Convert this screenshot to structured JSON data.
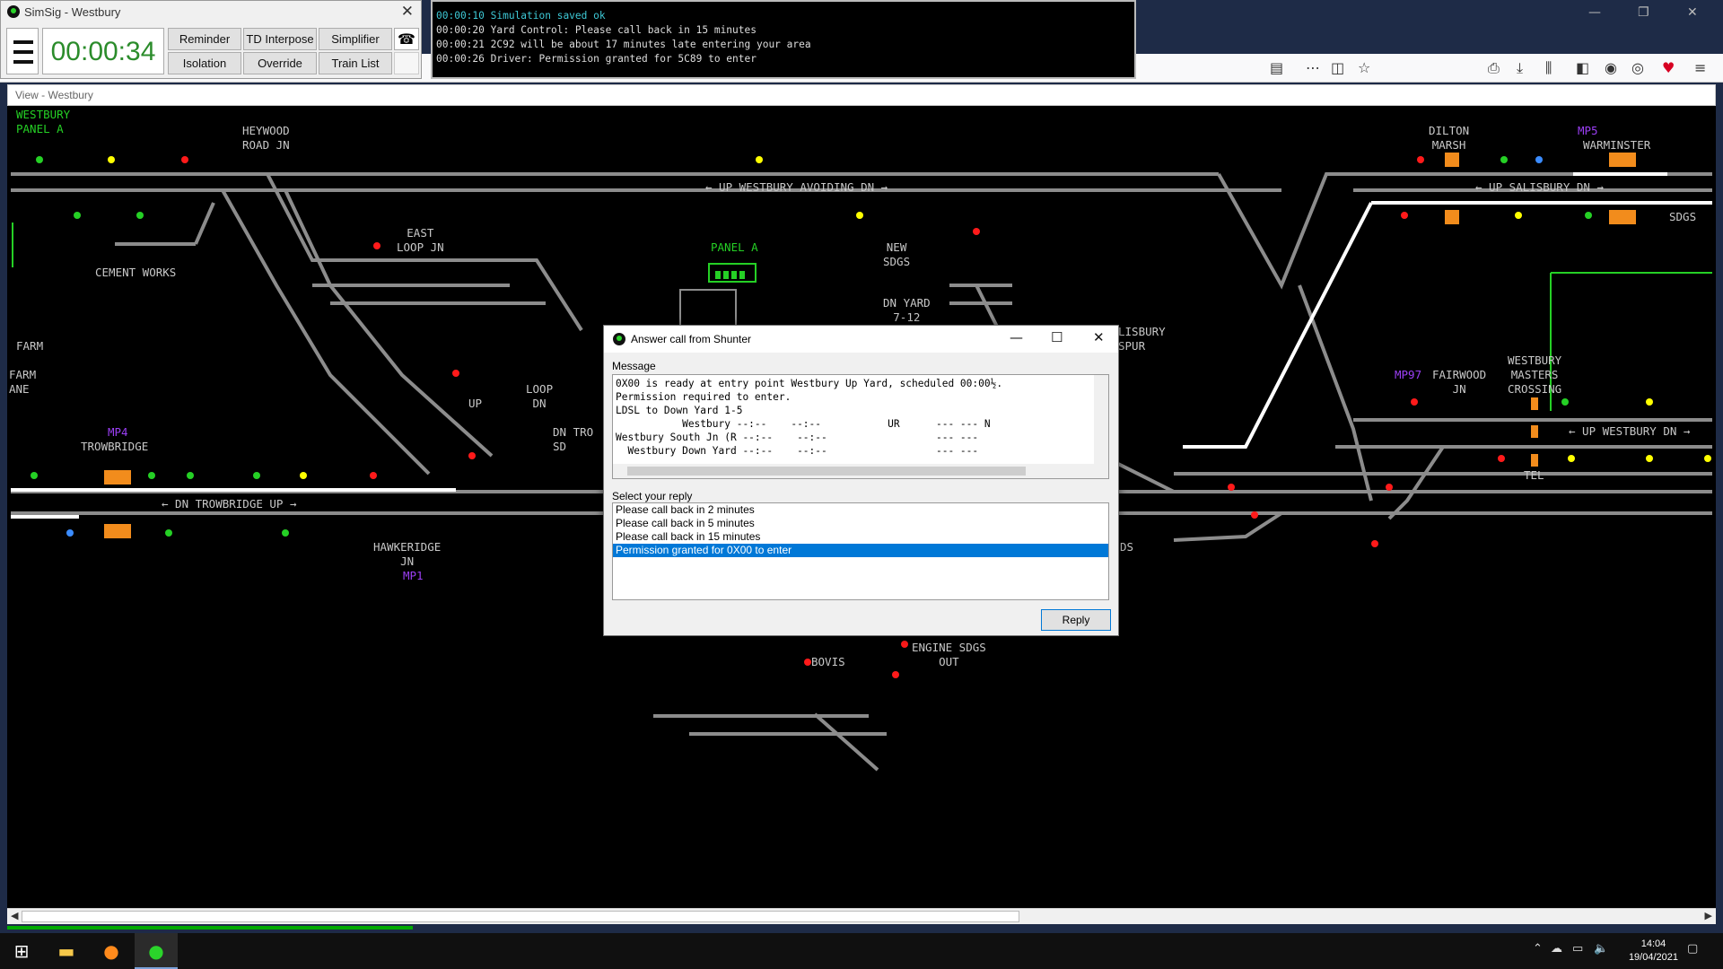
{
  "simsig": {
    "title": "SimSig - Westbury",
    "clock": "00:00:34",
    "buttons": [
      "Reminder",
      "TD Interpose",
      "Simplifier",
      "Isolation",
      "Override",
      "Train List"
    ]
  },
  "message_log": [
    "00:00:10 Simulation saved ok",
    "00:00:20 Yard Control: Please call back in 15 minutes",
    "00:00:21 2C92 will be about 17 minutes late entering your area",
    "00:00:26 Driver: Permission granted for 5C89 to enter"
  ],
  "view": {
    "title": "View - Westbury",
    "labels": {
      "westbury_panel_a": "WESTBURY\nPANEL A",
      "heywood_road_jn": "HEYWOOD\nROAD JN",
      "dilton_marsh": "DILTON\nMARSH",
      "mp5_warminster_mp": "MP5",
      "warminster": "WARMINSTER",
      "up_westbury_avoiding_dn": "← UP WESTBURY AVOIDING DN →",
      "up_salisbury_dn": "← UP SALISBURY DN →",
      "sdgs": "SDGS",
      "cement_works": "CEMENT WORKS",
      "east_loop_jn": "EAST\nLOOP JN",
      "panel_a": "PANEL A",
      "new_sdgs": "NEW\nSDGS",
      "dn_yard": "DN YARD\n7-12",
      "salisbury_spur": "LISBURY\nSPUR",
      "farm": "FARM",
      "farm_lane": "FARM\nANE",
      "loop_dn": "LOOP\nDN",
      "up": "UP",
      "dn_tro_sd": "DN TRO\nSD",
      "mp4": "MP4",
      "trowbridge": "TROWBRIDGE",
      "dn_trowbridge_up": "← DN TROWBRIDGE UP →",
      "hawkeridge_jn": "HAWKERIDGE\nJN",
      "mp1": "MP1",
      "mp97": "MP97",
      "fairwood_jn": "FAIRWOOD\nJN",
      "westbury_masters_crossing": "WESTBURY\nMASTERS\nCROSSING",
      "up_westbury_dn": "← UP WESTBURY DN →",
      "tel": "TEL",
      "bovis": "BOVIS",
      "engine_sdgs_out": "ENGINE SDGS\nOUT",
      "ds": "DS"
    }
  },
  "dialog": {
    "title": "Answer call from Shunter",
    "message_label": "Message",
    "message_lines": [
      "0X00 is ready at entry point Westbury Up Yard, scheduled 00:00½.",
      "Permission required to enter.",
      "LDSL to Down Yard 1-5",
      "           Westbury --:--    --:--           UR      --- --- N",
      "Westbury South Jn (R --:--    --:--                  --- ---",
      "  Westbury Down Yard --:--    --:--                  --- ---"
    ],
    "reply_label": "Select your reply",
    "replies": [
      "Please call back in 2 minutes",
      "Please call back in 5 minutes",
      "Please call back in 15 minutes",
      "Permission granted for 0X00 to enter"
    ],
    "selected_reply": 3,
    "reply_button": "Reply"
  },
  "taskbar": {
    "time": "14:04",
    "date": "19/04/2021"
  }
}
